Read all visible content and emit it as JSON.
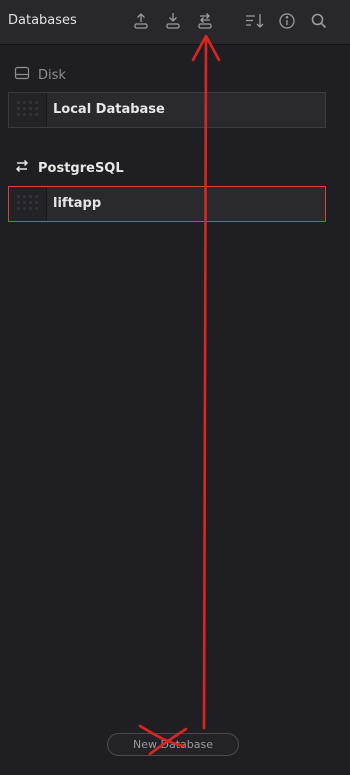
{
  "header": {
    "title": "Databases",
    "icons": [
      "upload-icon",
      "download-icon",
      "swap-icon",
      "sort-icon",
      "info-icon",
      "search-icon"
    ]
  },
  "sections": [
    {
      "label": "Disk",
      "icon": "disk-icon",
      "items": [
        {
          "name": "Local Database",
          "selected": false
        }
      ]
    },
    {
      "label": "PostgreSQL",
      "icon": "swap-arrows-icon",
      "items": [
        {
          "name": "liftapp",
          "selected": true
        }
      ]
    }
  ],
  "footer": {
    "new_database_label": "New Database"
  },
  "colors": {
    "background": "#1f1f23",
    "header": "#27272c",
    "selection_border": "#d2463f",
    "annotation": "#d9271f"
  }
}
